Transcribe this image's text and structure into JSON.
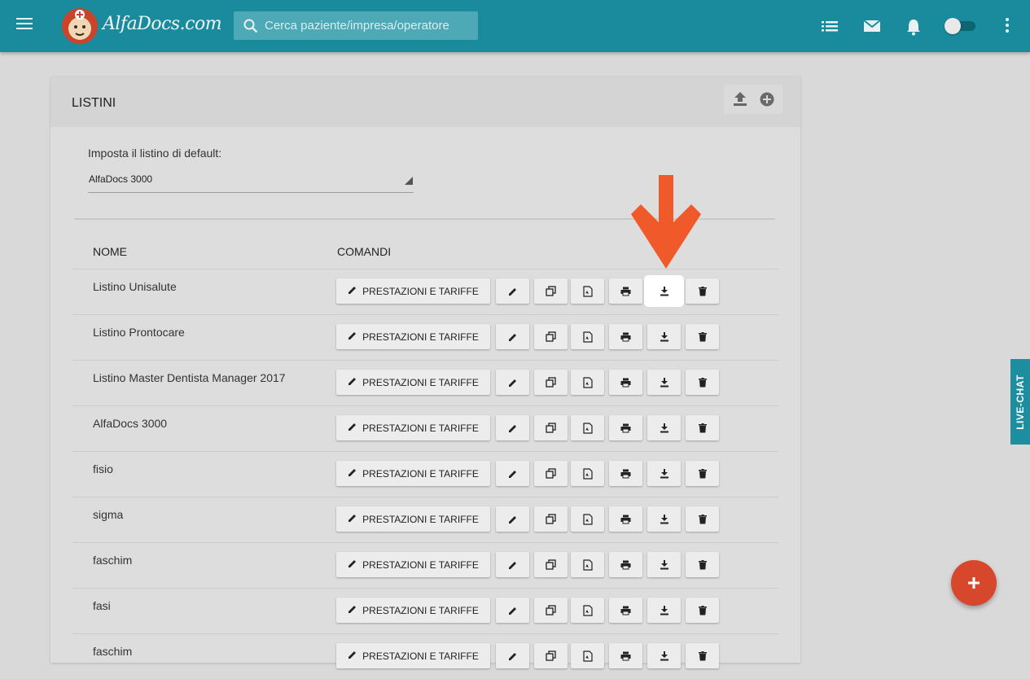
{
  "header": {
    "logo_text": "AlfaDocs.com",
    "search_placeholder": "Cerca paziente/impresa/operatore",
    "accent_color": "#1a8b9c"
  },
  "card": {
    "title": "LISTINI",
    "header_actions": [
      "upload-icon",
      "add-circle-icon"
    ],
    "default_label": "Imposta il listino di default:",
    "default_value": "AlfaDocs 3000"
  },
  "table": {
    "columns": [
      "NOME",
      "COMANDI"
    ],
    "primary_button_label": "PRESTAZIONI E TARIFFE",
    "row_actions": [
      "pencil-icon",
      "copy-icon",
      "pdf-icon",
      "print-icon",
      "download-icon",
      "trash-icon"
    ],
    "rows": [
      {
        "name": "Listino Unisalute"
      },
      {
        "name": "Listino Prontocare"
      },
      {
        "name": "Listino Master Dentista Manager 2017"
      },
      {
        "name": "AlfaDocs 3000"
      },
      {
        "name": "fisio"
      },
      {
        "name": "sigma"
      },
      {
        "name": "faschim"
      },
      {
        "name": "fasi"
      },
      {
        "name": "faschim"
      }
    ]
  },
  "livechat": {
    "label": "LIVE-CHAT"
  },
  "annotation": {
    "color": "#f05a2a"
  },
  "fab_color": "#d6472c"
}
